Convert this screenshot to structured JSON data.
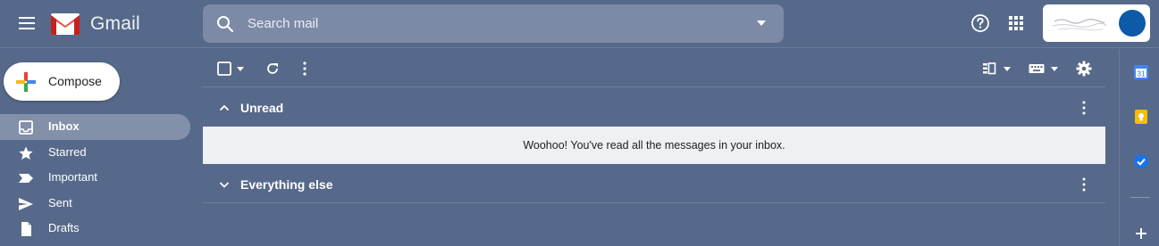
{
  "header": {
    "app_name": "Gmail",
    "search": {
      "placeholder": "Search mail",
      "value": ""
    }
  },
  "compose": {
    "label": "Compose"
  },
  "nav": {
    "items": [
      {
        "label": "Inbox",
        "icon": "inbox-icon",
        "active": true
      },
      {
        "label": "Starred",
        "icon": "star-icon",
        "active": false
      },
      {
        "label": "Important",
        "icon": "important-icon",
        "active": false
      },
      {
        "label": "Sent",
        "icon": "send-icon",
        "active": false
      },
      {
        "label": "Drafts",
        "icon": "draft-icon",
        "active": false
      }
    ]
  },
  "sections": {
    "unread": {
      "title": "Unread",
      "empty_message": "Woohoo! You've read all the messages in your inbox."
    },
    "everything_else": {
      "title": "Everything else"
    }
  },
  "side_panel": {
    "calendar_day": "31",
    "icons": [
      "calendar-icon",
      "keep-icon",
      "tasks-icon",
      "add-icon"
    ]
  },
  "colors": {
    "background": "#56698a",
    "search_bg": "#7c8aa6",
    "active_nav": "#8290a9",
    "empty_row_bg": "#eef0f4",
    "avatar": "#0c5aa8",
    "gmail_red": "#ea4335"
  }
}
